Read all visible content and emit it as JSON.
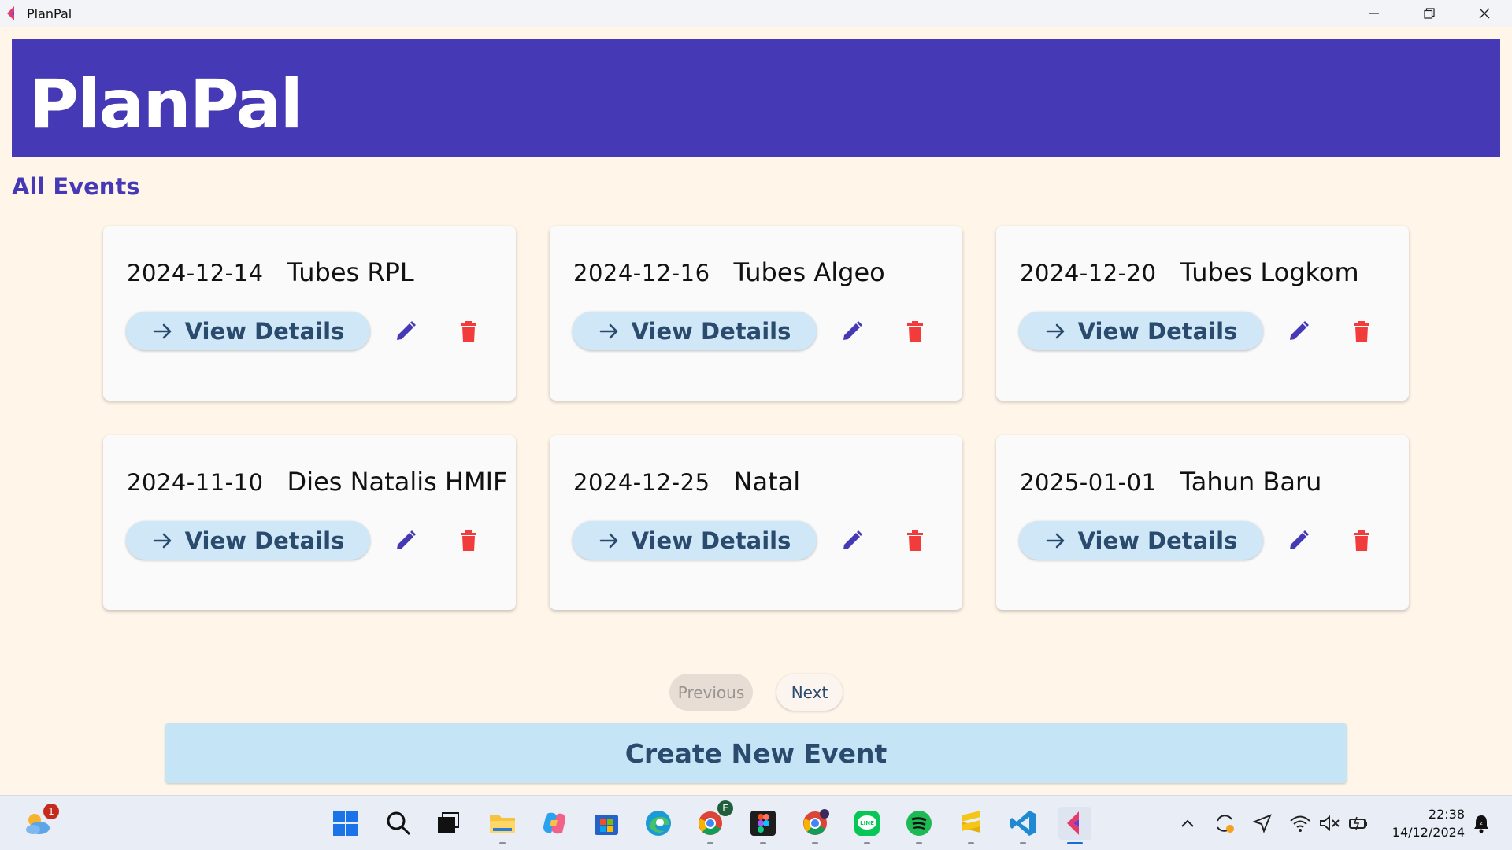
{
  "window": {
    "title": "PlanPal"
  },
  "header": {
    "title": "PlanPal"
  },
  "section": {
    "title": "All Events"
  },
  "events": [
    {
      "date": "2024-12-14",
      "name": "Tubes RPL",
      "details_label": "View Details"
    },
    {
      "date": "2024-12-16",
      "name": "Tubes Algeo",
      "details_label": "View Details"
    },
    {
      "date": "2024-12-20",
      "name": "Tubes Logkom",
      "details_label": "View Details"
    },
    {
      "date": "2024-11-10",
      "name": "Dies Natalis HMIF",
      "details_label": "View Details"
    },
    {
      "date": "2024-12-25",
      "name": "Natal",
      "details_label": "View Details"
    },
    {
      "date": "2025-01-01",
      "name": "Tahun Baru",
      "details_label": "View Details"
    }
  ],
  "pagination": {
    "previous_label": "Previous",
    "next_label": "Next"
  },
  "create_button": {
    "label": "Create New Event"
  },
  "colors": {
    "brand": "#4639b5",
    "background": "#fff5e9",
    "card": "#fafafa",
    "button": "#cfe7f7",
    "delete": "#f23b3b"
  },
  "taskbar": {
    "weather_badge": "1",
    "apps": [
      "start-icon",
      "search-icon",
      "task-view-icon",
      "file-explorer-icon",
      "copilot-icon",
      "store-icon",
      "edge-icon",
      "chrome-profile-e-icon",
      "figma-icon",
      "chrome-icon",
      "line-icon",
      "spotify-icon",
      "sublime-icon",
      "vscode-icon",
      "planpal-icon"
    ],
    "chrome_profile_letter": "E",
    "time": "22:38",
    "date": "14/12/2024"
  }
}
